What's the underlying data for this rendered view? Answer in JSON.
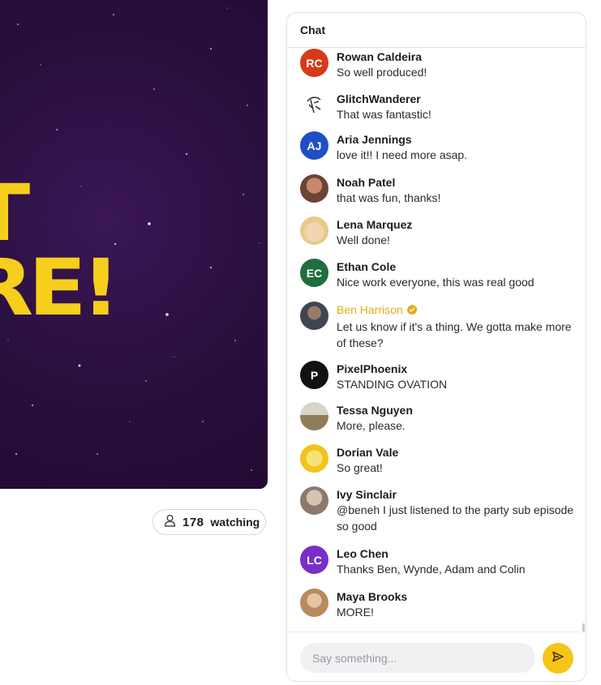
{
  "video": {
    "title_fragment_line1": "T",
    "title_fragment_line2": "RE!"
  },
  "viewers": {
    "count": "178",
    "label": "watching",
    "icon": "person-icon"
  },
  "chat": {
    "title": "Chat",
    "messages": [
      {
        "author": "Rowan Caldeira",
        "text": "So well produced!",
        "initials": "RC",
        "avatar_color": "#d63a1a"
      },
      {
        "author": "GlitchWanderer",
        "text": "That was fantastic!",
        "initials": "",
        "avatar_color": "#ffffff"
      },
      {
        "author": "Aria Jennings",
        "text": "love it!! I need more asap.",
        "initials": "AJ",
        "avatar_color": "#1f4fc4"
      },
      {
        "author": "Noah Patel",
        "text": "that was fun, thanks!",
        "initials": "",
        "avatar_color": "#8a5a4a"
      },
      {
        "author": "Lena Marquez",
        "text": "Well done!",
        "initials": "",
        "avatar_color": "#e8c98a"
      },
      {
        "author": "Ethan Cole",
        "text": "Nice work everyone, this was real good",
        "initials": "EC",
        "avatar_color": "#1f6e3d"
      },
      {
        "author": "Ben Harrison",
        "text": "Let us know if it's a thing. We gotta make more of these?",
        "initials": "",
        "avatar_color": "#5a5a5a",
        "verified": true
      },
      {
        "author": "PixelPhoenix",
        "text": "STANDING OVATION",
        "initials": "P",
        "avatar_color": "#111111"
      },
      {
        "author": "Tessa Nguyen",
        "text": "More, please.",
        "initials": "",
        "avatar_color": "#a99a7a"
      },
      {
        "author": "Dorian Vale",
        "text": "So great!",
        "initials": "",
        "avatar_color": "#f0c419"
      },
      {
        "author": "Ivy Sinclair",
        "text": "@beneh I just listened to the party sub episode so good",
        "initials": "",
        "avatar_color": "#b8aea6"
      },
      {
        "author": "Leo Chen",
        "text": "Thanks Ben, Wynde, Adam and Colin",
        "initials": "LC",
        "avatar_color": "#7a2ec8"
      },
      {
        "author": "Maya Brooks",
        "text": "MORE!",
        "initials": "",
        "avatar_color": "#c9a07a"
      }
    ],
    "input_placeholder": "Say something...",
    "send_icon": "send-icon",
    "accent_color": "#f5c518",
    "verified_color": "#e6a817"
  }
}
